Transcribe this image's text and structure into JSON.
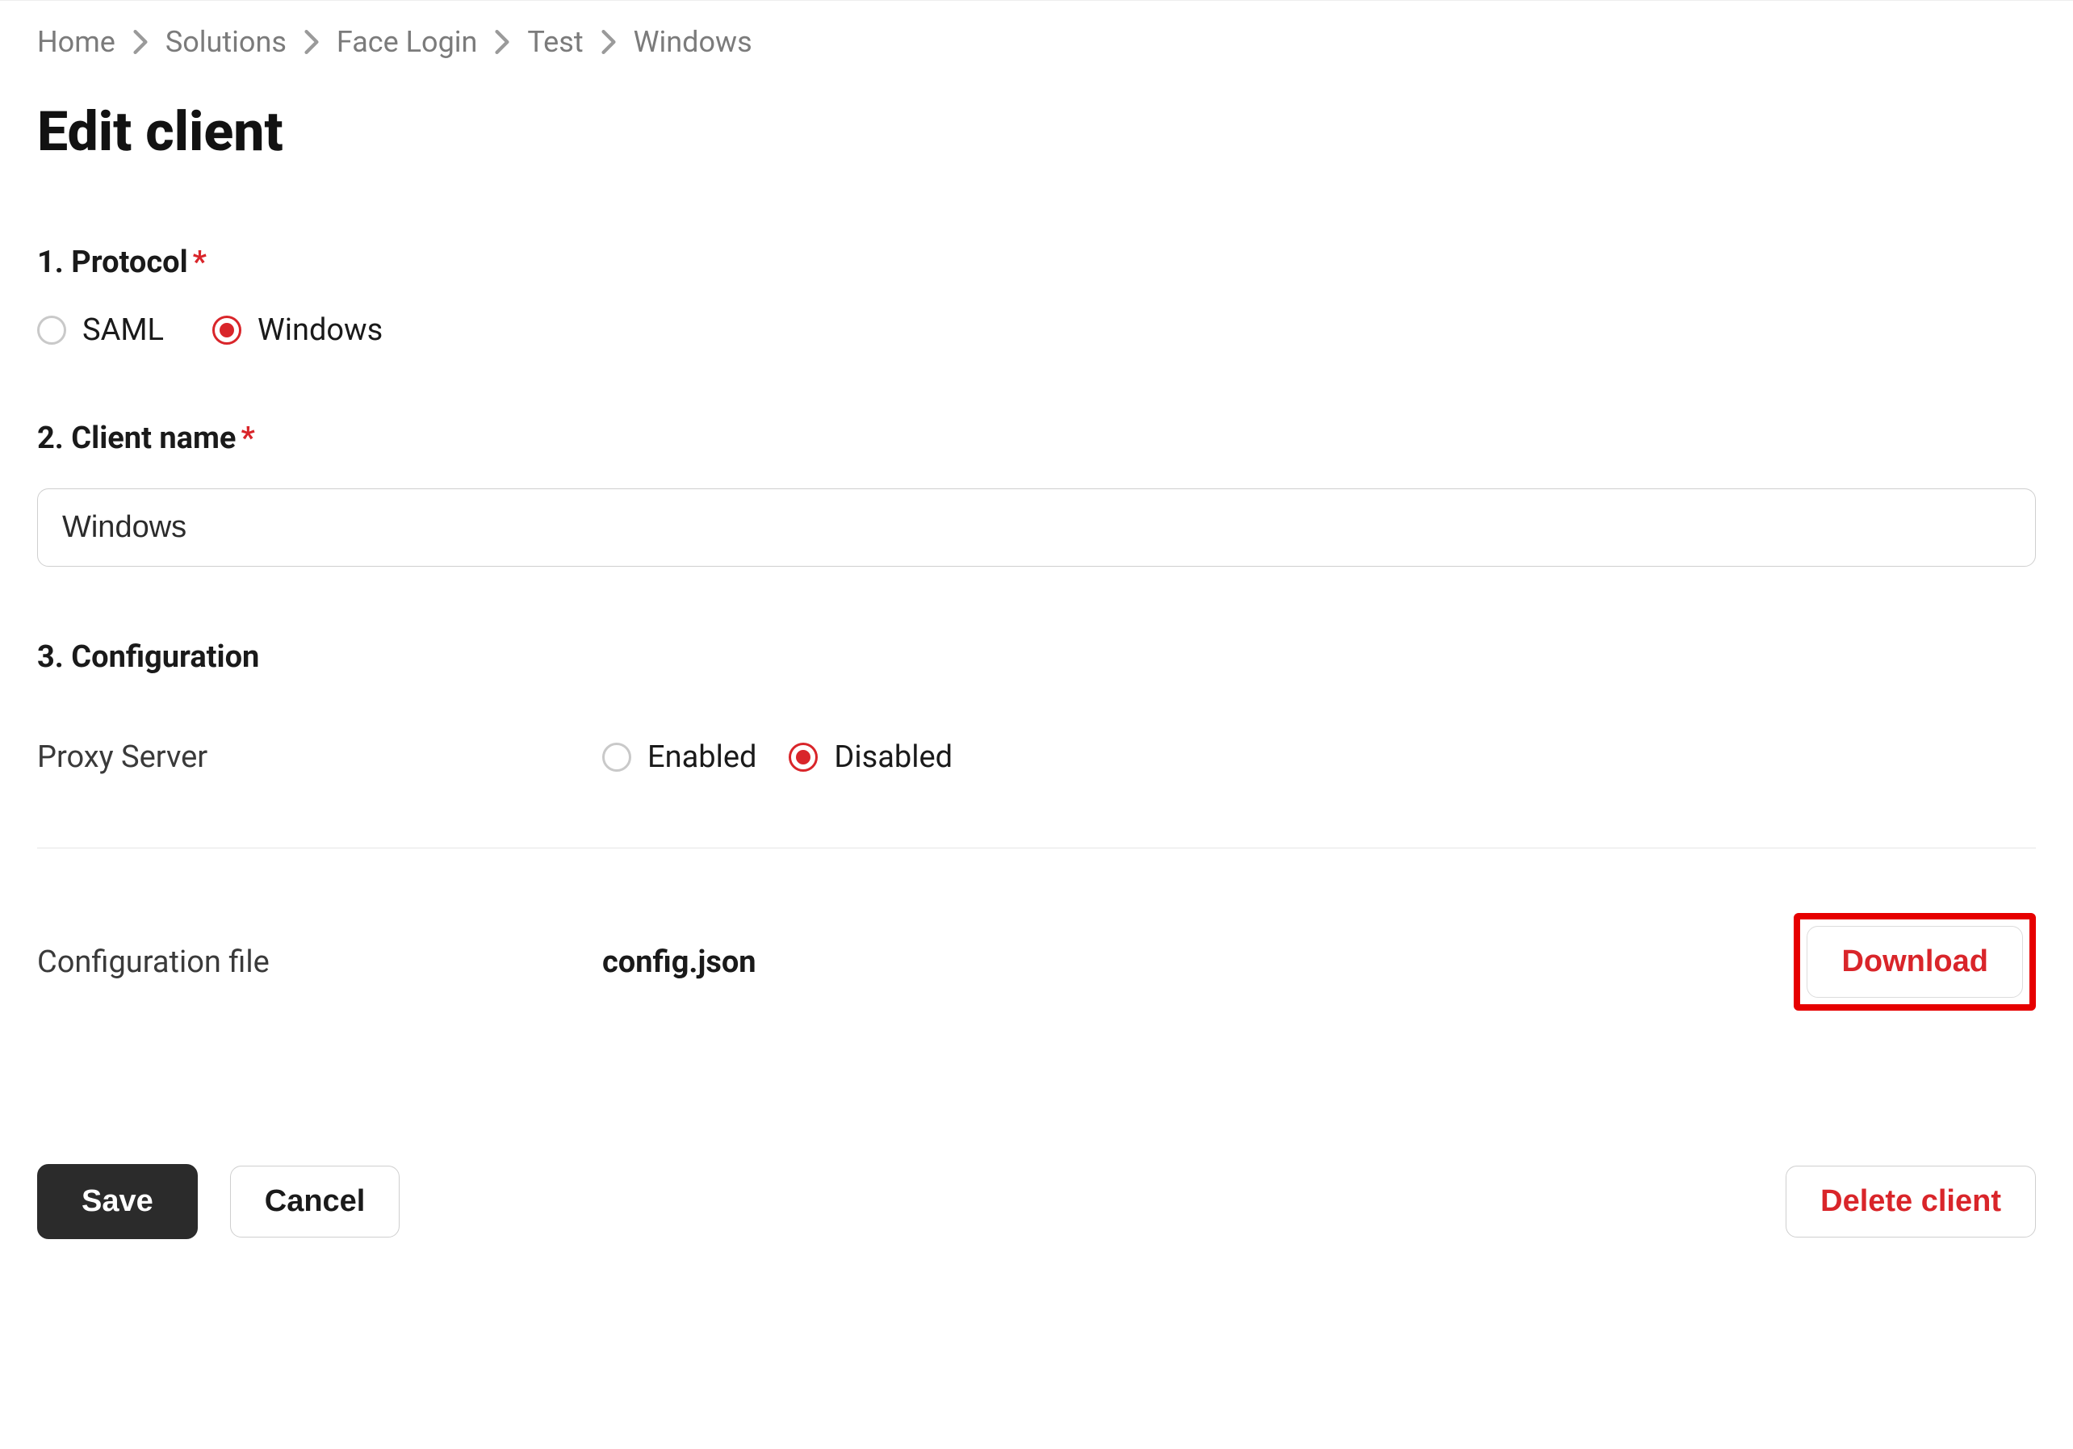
{
  "breadcrumb": {
    "items": [
      "Home",
      "Solutions",
      "Face Login",
      "Test",
      "Windows"
    ]
  },
  "page": {
    "title": "Edit client"
  },
  "sections": {
    "protocol": {
      "label": "1. Protocol",
      "required_mark": "*",
      "options": {
        "saml": "SAML",
        "windows": "Windows"
      },
      "selected": "windows"
    },
    "client_name": {
      "label": "2. Client name",
      "required_mark": "*",
      "value": "Windows"
    },
    "configuration": {
      "label": "3. Configuration",
      "proxy_label": "Proxy Server",
      "proxy_options": {
        "enabled": "Enabled",
        "disabled": "Disabled"
      },
      "proxy_selected": "disabled",
      "file_label": "Configuration file",
      "file_name": "config.json",
      "download_label": "Download"
    }
  },
  "actions": {
    "save": "Save",
    "cancel": "Cancel",
    "delete": "Delete client"
  }
}
